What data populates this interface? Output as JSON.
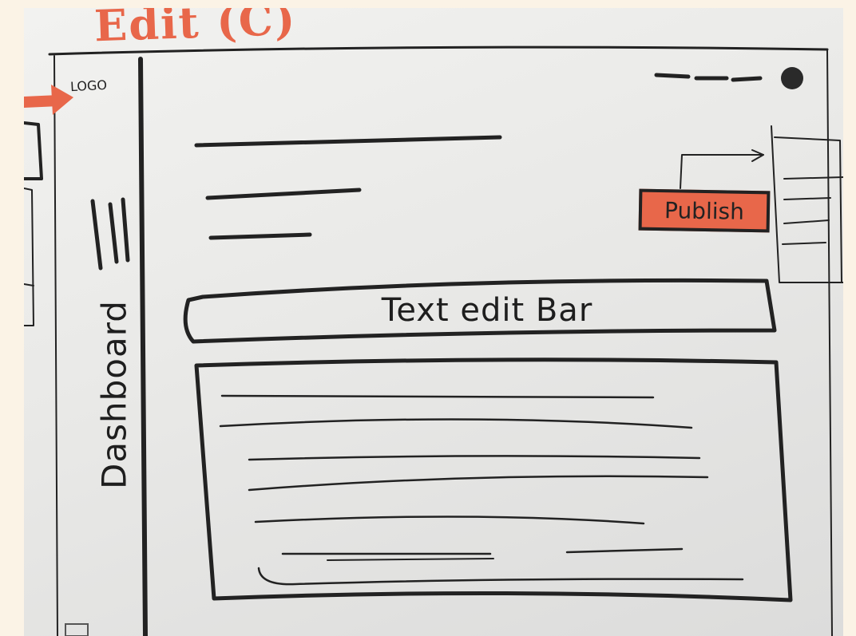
{
  "page": {
    "title": "Edit (C)"
  },
  "header": {
    "logo_text": "LOGO"
  },
  "sidebar": {
    "label": "Dashboard"
  },
  "actions": {
    "publish_label": "Publish"
  },
  "editor": {
    "toolbar_label": "Text edit Bar"
  },
  "colors": {
    "accent": "#e8674a",
    "ink": "#222222",
    "paper": "#eeeeec"
  },
  "icons": [
    "hamburger-icon",
    "avatar-icon",
    "arrow-icon"
  ]
}
